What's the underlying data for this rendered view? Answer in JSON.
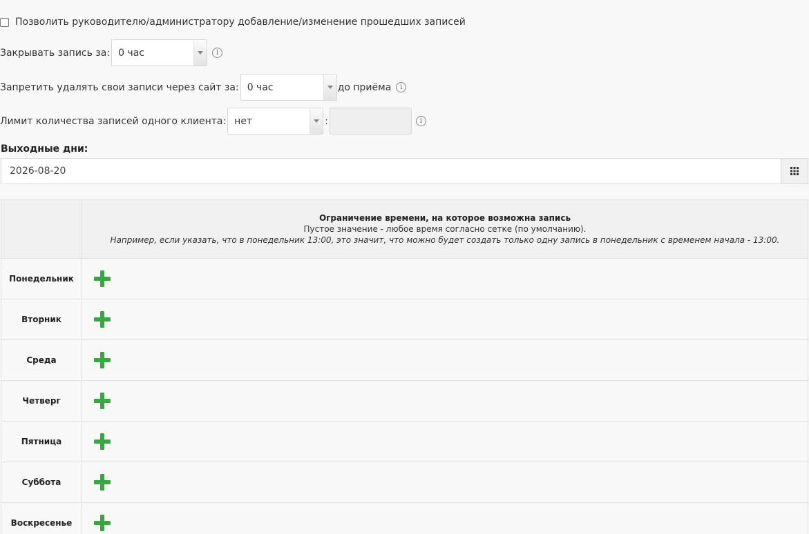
{
  "allow_past": {
    "label": "Позволить руководителю/администратору добавление/изменение прошедших записей",
    "checked": false
  },
  "close_booking": {
    "label": "Закрывать запись за:",
    "value": "0 час",
    "info_icon": "info-circle-icon"
  },
  "forbid_delete": {
    "label": "Запретить удалять свои записи через сайт за:",
    "value": "0 час",
    "suffix": "до приёма",
    "info_icon": "info-circle-icon"
  },
  "client_limit": {
    "label": "Лимит количества записей одного клиента:",
    "value": "нет",
    "separator": ":",
    "count_value": "",
    "info_icon": "info-circle-icon"
  },
  "weekends": {
    "label": "Выходные дни:",
    "value": "2026-08-20",
    "picker_icon": "grid-calendar-icon"
  },
  "time_restriction": {
    "title": "Ограничение времени, на которое возможна запись",
    "subtitle": "Пустое значение - любое время согласно сетке (по умолчанию).",
    "note": "Например, если указать, что в понедельник 13:00, это значит, что можно будет создать только одну запись в понедельник с временем начала - 13:00.",
    "days": [
      "Понедельник",
      "Вторник",
      "Среда",
      "Четверг",
      "Пятница",
      "Суббота",
      "Воскресенье"
    ],
    "add_icon": "plus-icon",
    "accent_color": "#3aa642"
  }
}
